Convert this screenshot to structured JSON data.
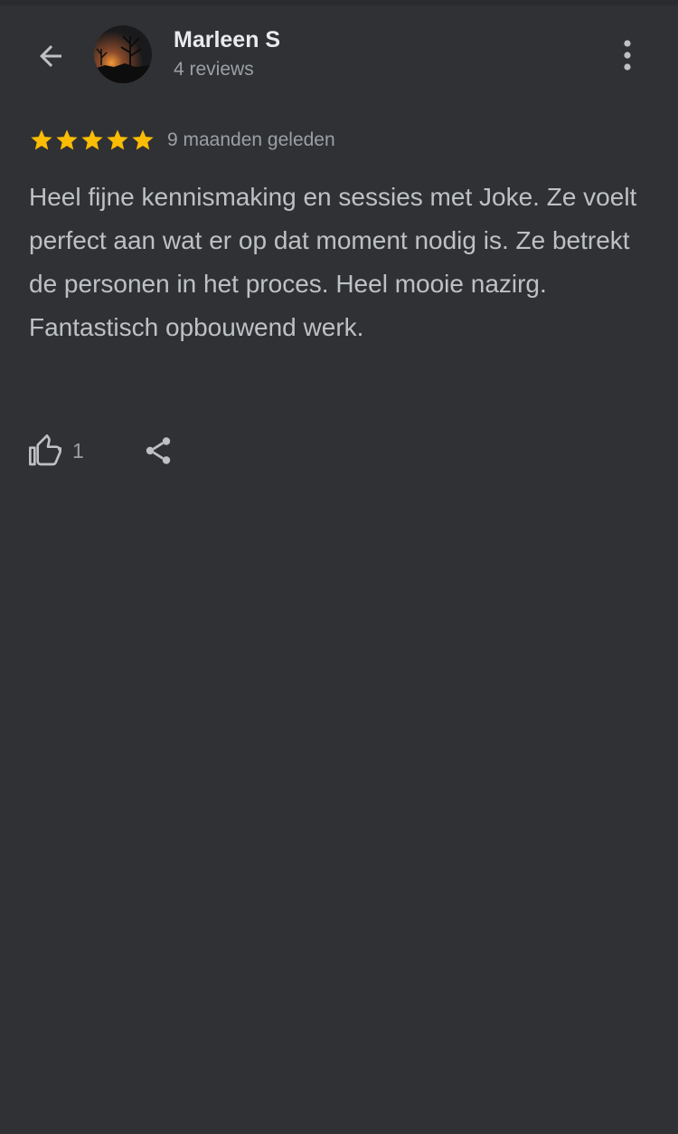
{
  "header": {
    "author_name": "Marleen S",
    "review_count": "4 reviews",
    "back_icon": "arrow-back-icon",
    "more_icon": "more-vert-icon"
  },
  "review": {
    "rating": 5,
    "rating_max": 5,
    "date": "9 maanden geleden",
    "text": "Heel fijne kennismaking en sessies met Joke. Ze voelt perfect aan wat er op dat moment nodig is. Ze betrekt de personen in het proces. Heel mooie nazirg. Fantastisch opbouwend werk."
  },
  "actions": {
    "like_count": "1",
    "like_icon": "thumb-up-icon",
    "share_icon": "share-icon"
  },
  "colors": {
    "background": "#303134",
    "star": "#fbbc04",
    "primary_text": "#e8eaed",
    "secondary_text": "#9aa0a6"
  }
}
